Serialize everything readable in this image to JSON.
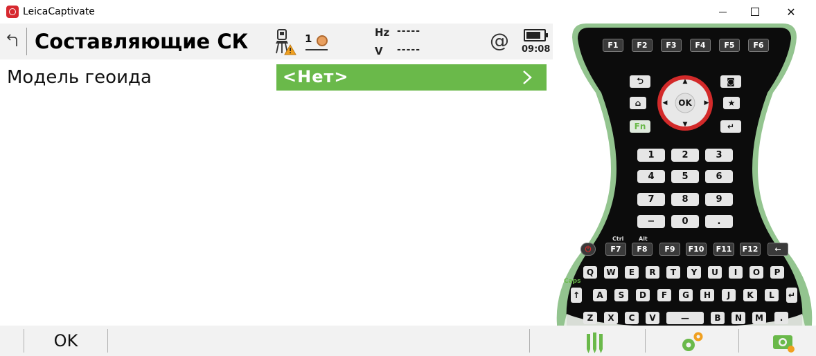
{
  "window": {
    "title": "LeicaCaptivate",
    "minimize_label": "",
    "maximize_label": "",
    "close_label": "✕"
  },
  "header": {
    "title": "Составляющие СК",
    "target_number": "1",
    "hz_label": "Hz",
    "hz_value": "-----",
    "v_label": "V",
    "v_value": "-----",
    "at_symbol": "@",
    "clock": "09:08"
  },
  "form": {
    "geoid_label": "Модель геоида",
    "geoid_value": "<Нет>"
  },
  "softkeys": {
    "ok_label": "OK"
  },
  "keyboard": {
    "fkeys_top": [
      "F1",
      "F2",
      "F3",
      "F4",
      "F5",
      "F6"
    ],
    "ok_label": "OK",
    "fn_label": "Fn",
    "numpad_rows": [
      [
        "1",
        "2",
        "3"
      ],
      [
        "4",
        "5",
        "6"
      ],
      [
        "7",
        "8",
        "9"
      ],
      [
        "−",
        "0",
        "."
      ]
    ],
    "fkeys_bottom": [
      "F7",
      "F8",
      "F9",
      "F10",
      "F11",
      "F12"
    ],
    "ctrl_label": "Ctrl",
    "alt_label": "Alt",
    "caps_label": "Caps",
    "row_q": [
      "Q",
      "W",
      "E",
      "R",
      "T",
      "Y",
      "U",
      "I",
      "O",
      "P"
    ],
    "row_a": [
      "A",
      "S",
      "D",
      "F",
      "G",
      "H",
      "J",
      "K",
      "L"
    ],
    "row_z": [
      "Z",
      "X",
      "C",
      "V",
      "B",
      "N",
      "M",
      "."
    ],
    "row_q_sym": [
      "@",
      "!",
      "$",
      "%",
      "&",
      "(",
      ")",
      "=",
      "?"
    ],
    "row_a_sym": [
      "'",
      "+",
      "*",
      "~",
      "[",
      "]",
      "{",
      "}",
      "<",
      ">"
    ],
    "row_z_sym": [
      "\"",
      "#",
      ":",
      ";",
      "_",
      "-",
      "|",
      "/",
      "\\",
      ","
    ]
  },
  "colors": {
    "accent_green": "#6ab94a",
    "keypad_red": "#d32a2a",
    "keypad_body": "#0c0c0c",
    "keypad_rim": "#93c48f"
  }
}
